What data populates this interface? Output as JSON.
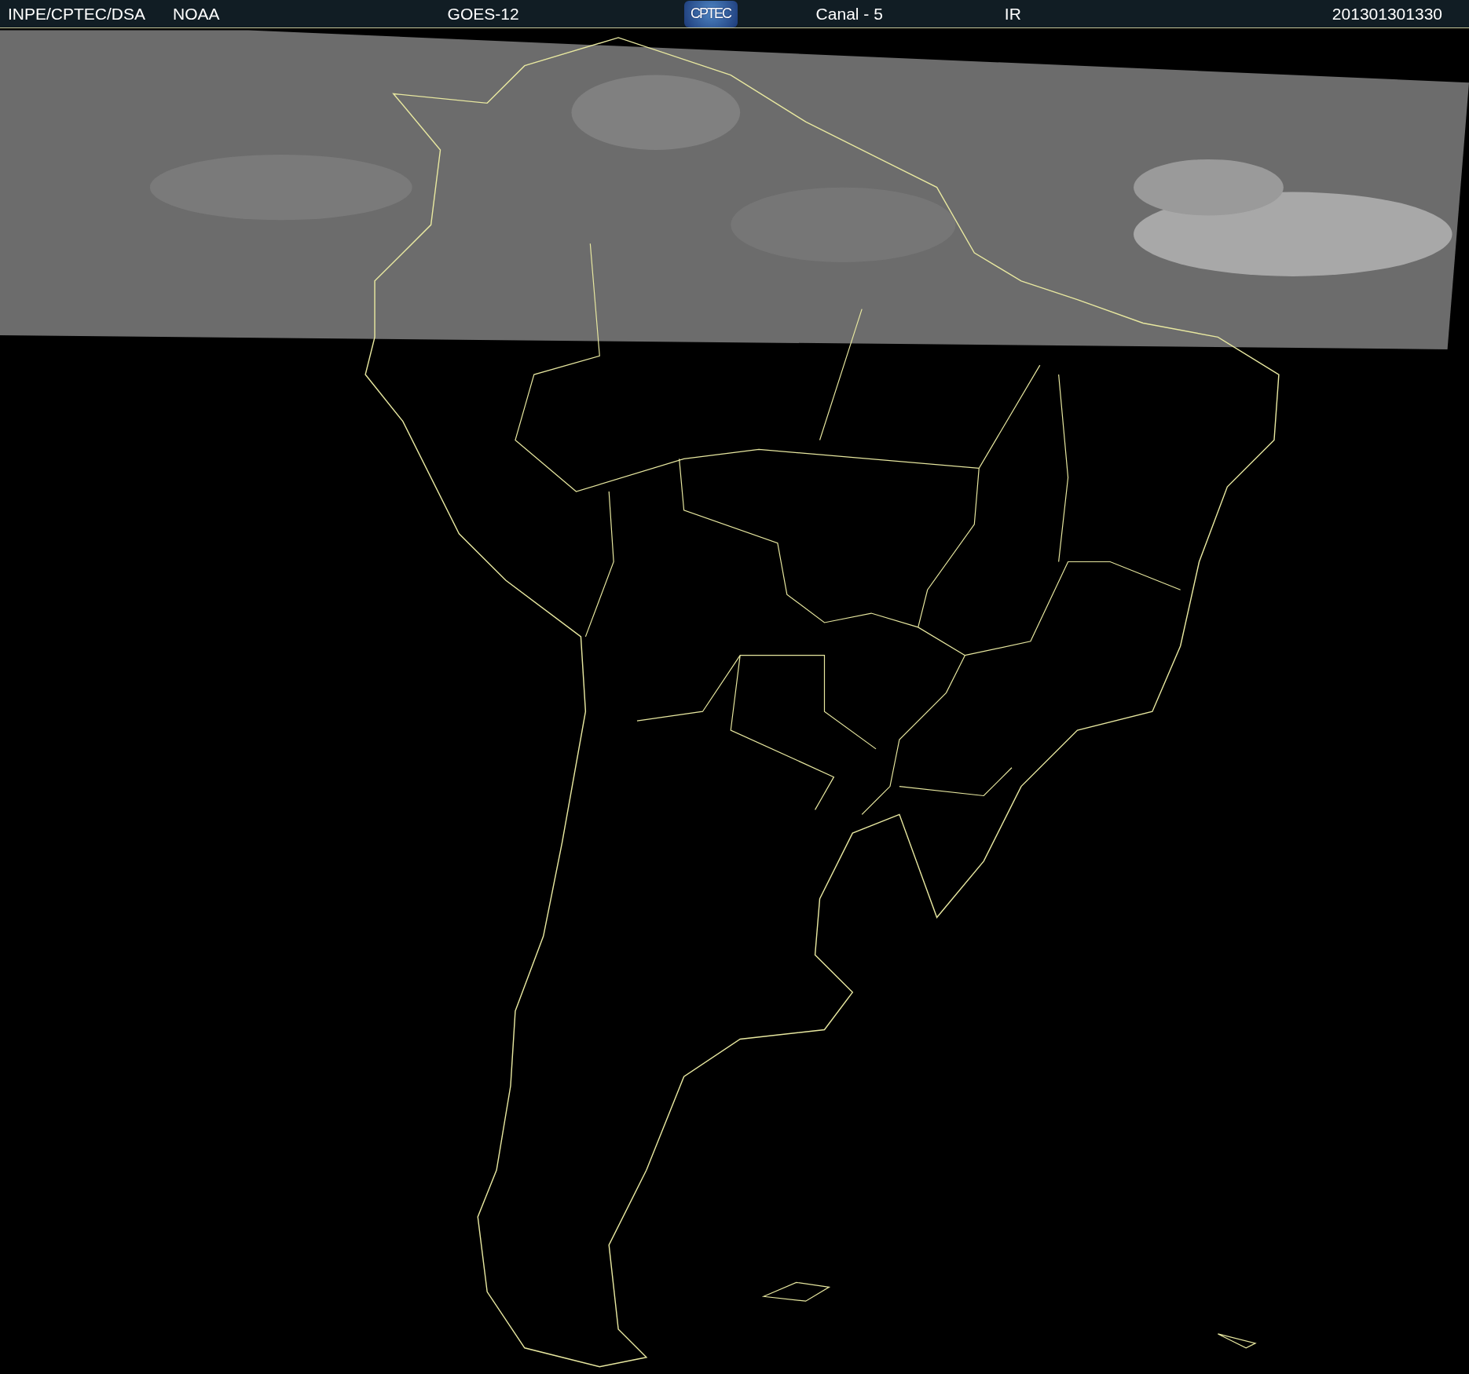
{
  "header": {
    "labels": [
      {
        "text": "INPE/CPTEC/DSA"
      },
      {
        "text": "NOAA"
      },
      {
        "text": "GOES-12"
      }
    ],
    "logo": {
      "text": "CPTEC"
    },
    "right_labels": [
      {
        "text": "Canal - 5"
      },
      {
        "text": "IR"
      },
      {
        "text": "201301301330"
      }
    ]
  }
}
